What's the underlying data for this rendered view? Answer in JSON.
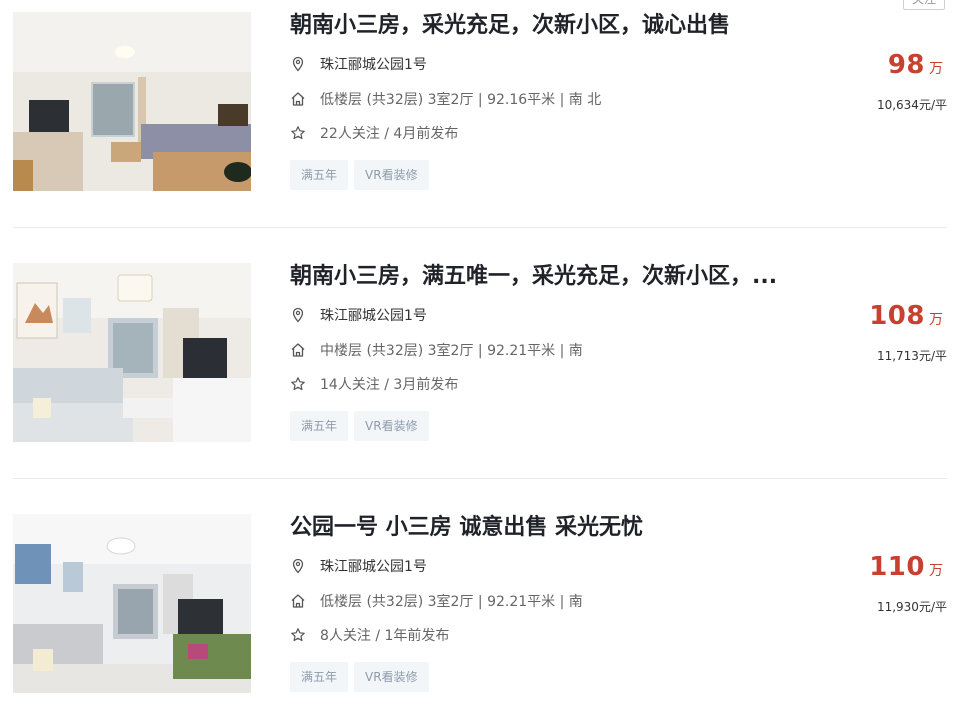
{
  "follow_button": "关注",
  "listings": [
    {
      "title": "朝南小三房，采光充足，次新小区，诚心出售",
      "community": "珠江郦城公园1号",
      "house_info": "低楼层 (共32层) 3室2厅 | 92.16平米 | 南 北",
      "follow_info": "22人关注 / 4月前发布",
      "tags": [
        "满五年",
        "VR看装修"
      ],
      "total_price": "98",
      "total_unit": "万",
      "unit_price": "10,634元/平"
    },
    {
      "title": "朝南小三房，满五唯一，采光充足，次新小区，...",
      "community": "珠江郦城公园1号",
      "house_info": "中楼层 (共32层) 3室2厅 | 92.21平米 | 南",
      "follow_info": "14人关注 / 3月前发布",
      "tags": [
        "满五年",
        "VR看装修"
      ],
      "total_price": "108",
      "total_unit": "万",
      "unit_price": "11,713元/平"
    },
    {
      "title": "公园一号 小三房 诚意出售 采光无忧",
      "community": "珠江郦城公园1号",
      "house_info": "低楼层 (共32层) 3室2厅 | 92.21平米 | 南",
      "follow_info": "8人关注 / 1年前发布",
      "tags": [
        "满五年",
        "VR看装修"
      ],
      "total_price": "110",
      "total_unit": "万",
      "unit_price": "11,930元/平"
    }
  ],
  "icons": {
    "location": "location-pin-icon",
    "house": "house-icon",
    "star": "star-icon"
  },
  "colors": {
    "price": "#c8402f",
    "title": "#1f2329",
    "tag_text": "#8d9cab",
    "tag_bg": "#f3f6f9"
  }
}
